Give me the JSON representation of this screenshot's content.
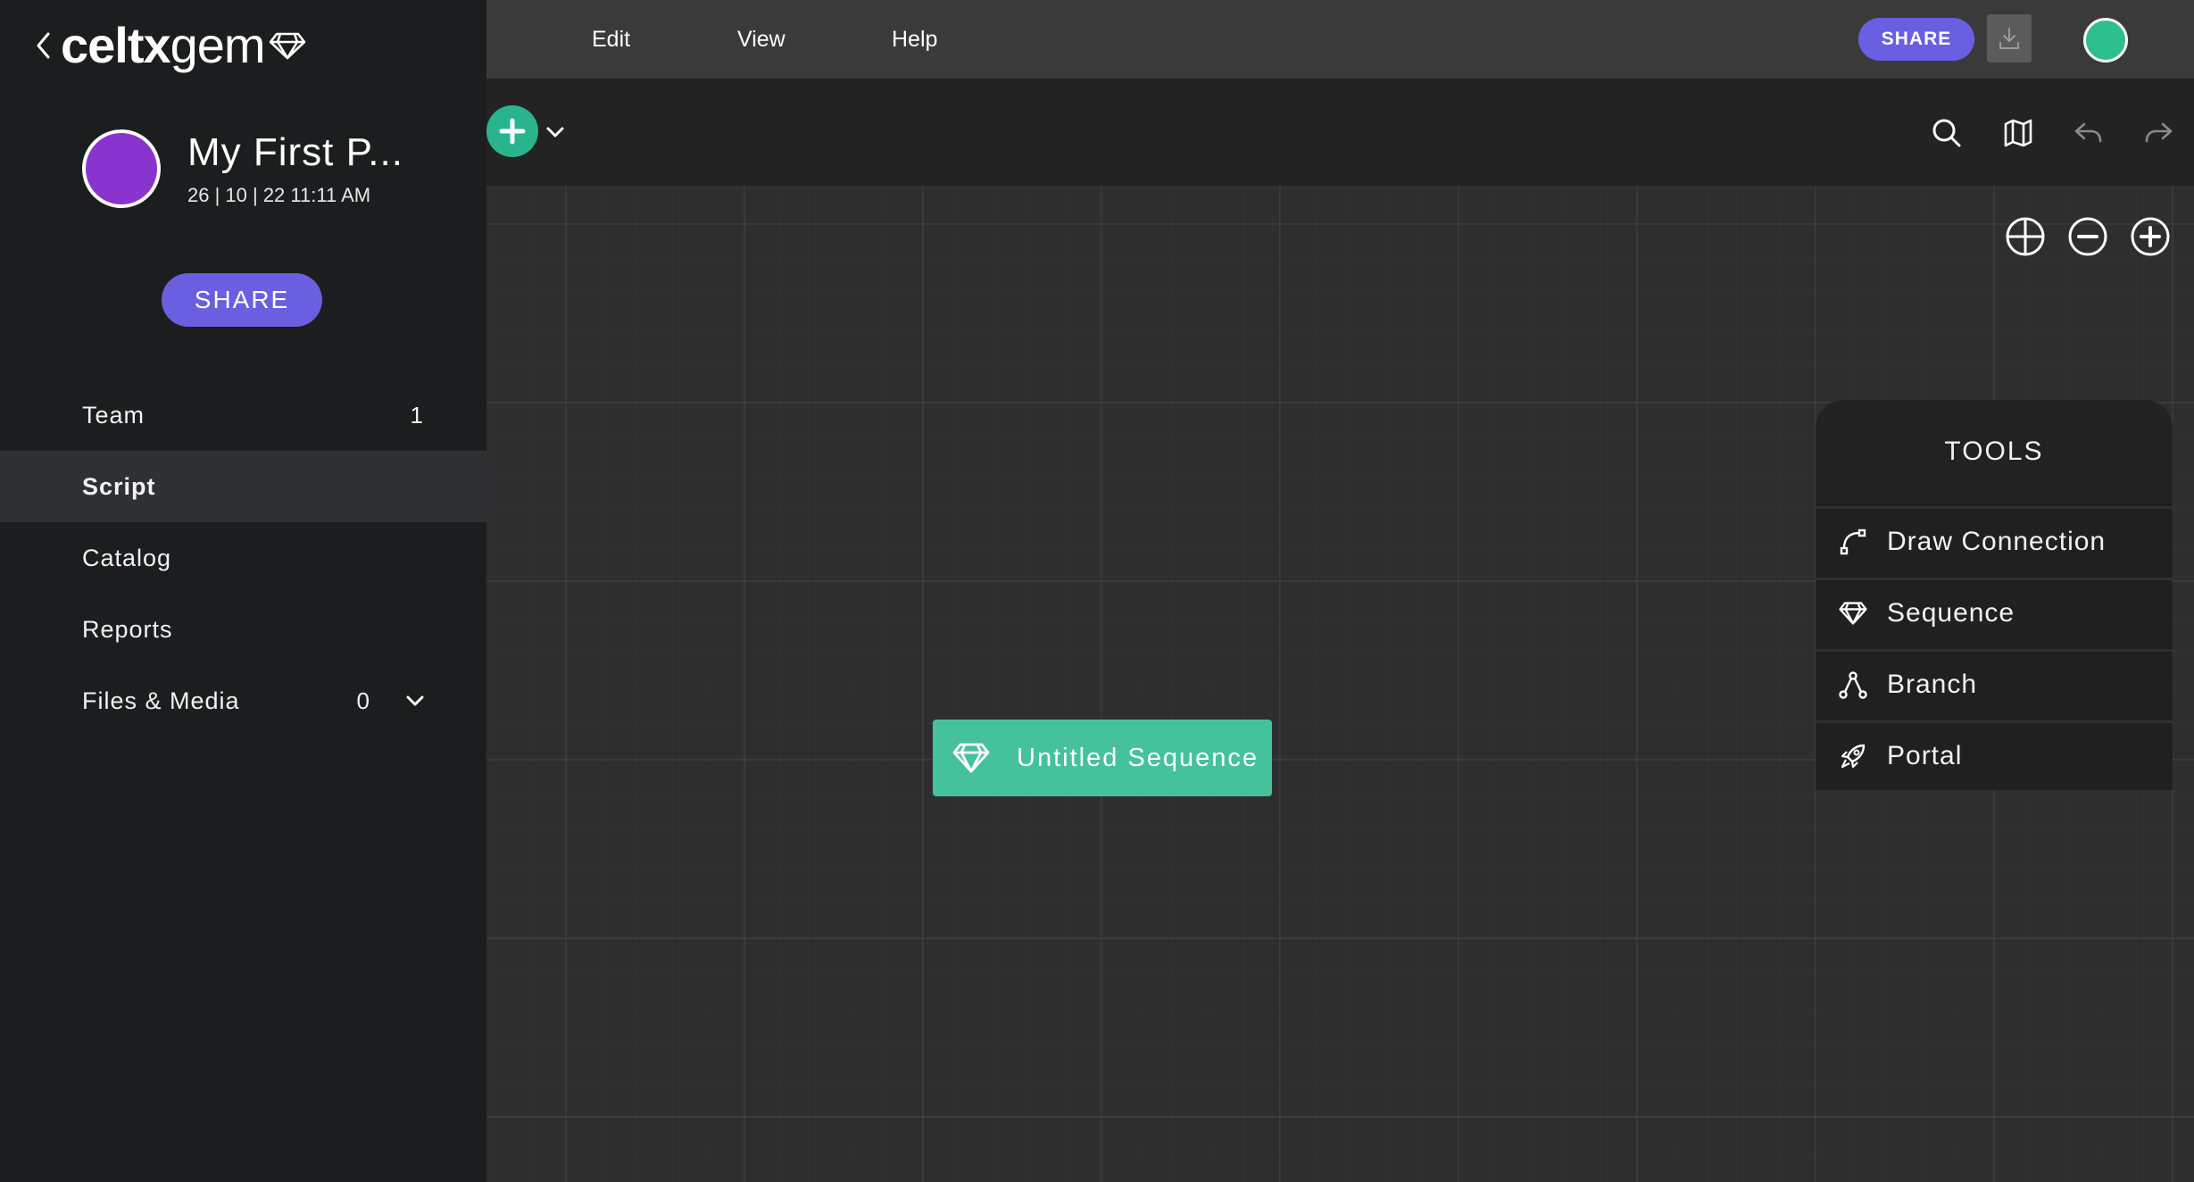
{
  "brand": {
    "logo_bold": "celtx",
    "logo_light": "gem"
  },
  "project": {
    "title": "My First P...",
    "date": "26 | 10 | 22 11:11 AM"
  },
  "sidebar": {
    "share_label": "SHARE",
    "items": [
      {
        "label": "Team",
        "count": "1",
        "active": false
      },
      {
        "label": "Script",
        "count": "",
        "active": true
      },
      {
        "label": "Catalog",
        "count": "",
        "active": false
      },
      {
        "label": "Reports",
        "count": "",
        "active": false
      },
      {
        "label": "Files & Media",
        "count": "0",
        "active": false
      }
    ]
  },
  "menu": {
    "edit": "Edit",
    "view": "View",
    "help": "Help"
  },
  "topbar": {
    "share_label": "SHARE"
  },
  "canvas": {
    "node_label": "Untitled Sequence"
  },
  "tools": {
    "title": "TOOLS",
    "items": [
      {
        "label": "Draw Connection",
        "icon": "draw-connection-icon"
      },
      {
        "label": "Sequence",
        "icon": "gem-icon"
      },
      {
        "label": "Branch",
        "icon": "branch-icon"
      },
      {
        "label": "Portal",
        "icon": "rocket-icon"
      }
    ]
  },
  "colors": {
    "accent_purple": "#6a5fe0",
    "accent_green": "#45c29b",
    "avatar_purple": "#8a34d0",
    "user_green": "#2ebf8f"
  }
}
